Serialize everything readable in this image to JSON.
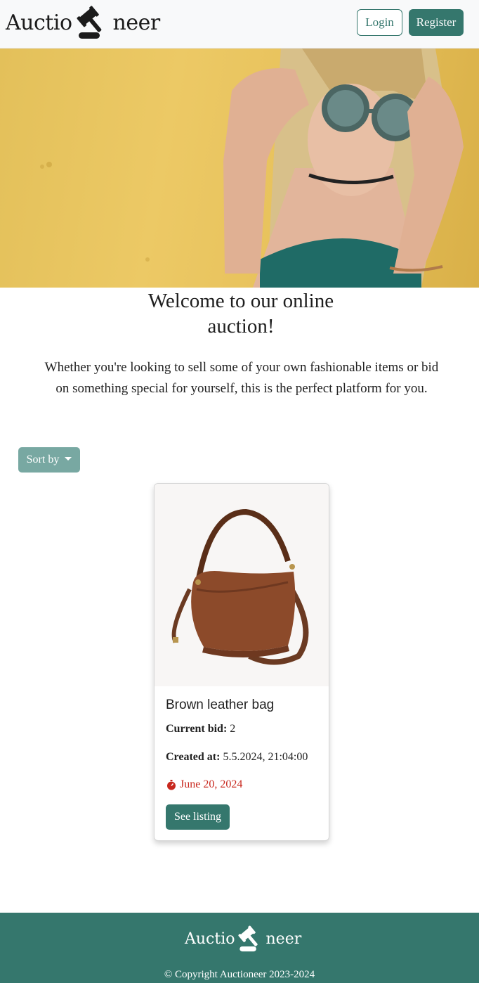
{
  "brand": {
    "logo_left": "Auctio",
    "logo_right": "neer"
  },
  "nav": {
    "login_label": "Login",
    "register_label": "Register"
  },
  "hero": {
    "image": "woman-with-sunglasses-photo"
  },
  "welcome": {
    "title_line1": "Welcome to our online",
    "title_line2": "auction!",
    "text": "Whether you're looking to sell some of your own fashionable items or bid on something special for yourself, this is the perfect platform for you."
  },
  "sort": {
    "label": "Sort by"
  },
  "listings": [
    {
      "image": "brown-leather-bag",
      "title": "Brown leather bag",
      "current_bid_label": "Current bid:",
      "current_bid": "2",
      "created_label": "Created at:",
      "created_at": "5.5.2024, 21:04:00",
      "deadline": "June 20, 2024",
      "button_label": "See listing"
    }
  ],
  "footer": {
    "copyright": "© Copyright Auctioneer 2023-2024"
  },
  "colors": {
    "primary": "#35776d",
    "sort_button": "#78a8a2",
    "deadline": "#c8281e",
    "navbar": "#f8f9fa"
  }
}
